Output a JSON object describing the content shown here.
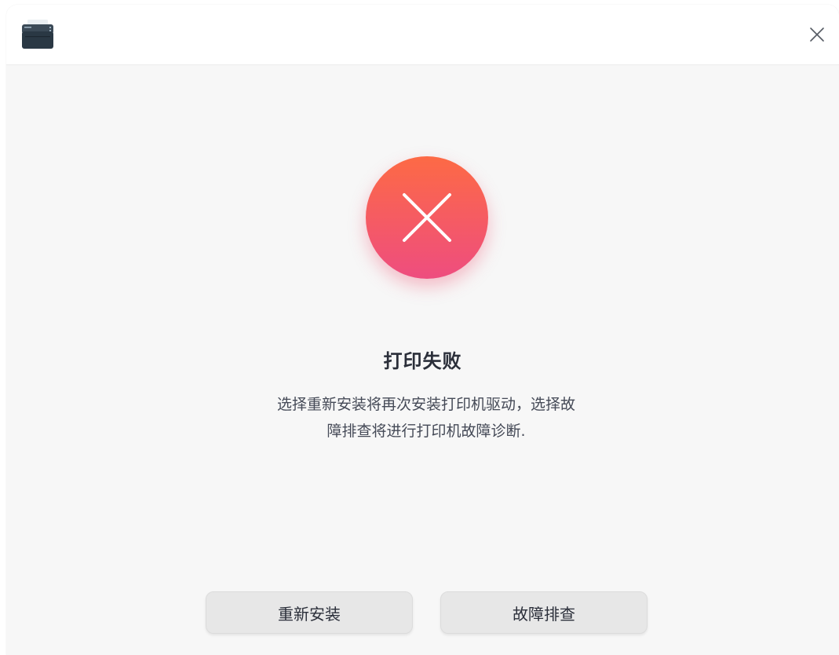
{
  "window": {
    "app_icon": "printer-icon",
    "close_icon": "close-icon"
  },
  "status": {
    "icon": "error-x-icon",
    "colors": {
      "gradient_top": "#fd6a45",
      "gradient_bottom": "#ee4d7f"
    },
    "title": "打印失败",
    "description_line1": "选择重新安装将再次安装打印机驱动，选择故",
    "description_line2": "障排查将进行打印机故障诊断."
  },
  "actions": {
    "reinstall_label": "重新安装",
    "troubleshoot_label": "故障排查"
  }
}
